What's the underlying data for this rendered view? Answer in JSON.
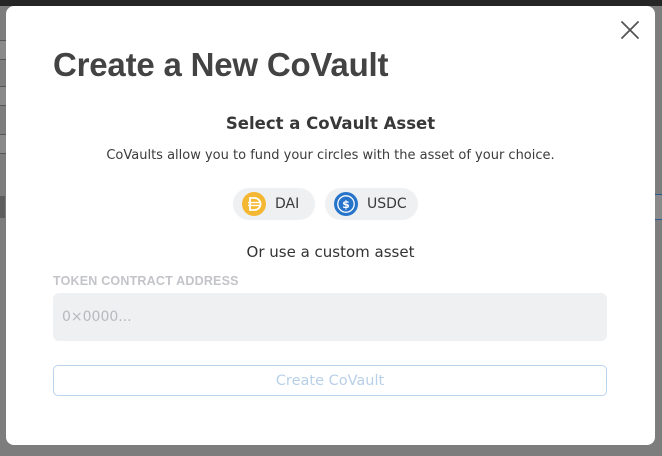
{
  "modal": {
    "title": "Create a New CoVault",
    "close_icon": "close-icon",
    "section_title": "Select a CoVault Asset",
    "section_description": "CoVaults allow you to fund your circles with the asset of your choice.",
    "assets": [
      {
        "label": "DAI",
        "icon": "dai-icon",
        "color": "#F4B731"
      },
      {
        "label": "USDC",
        "icon": "usdc-icon",
        "color": "#2775CA"
      }
    ],
    "custom_asset_text": "Or use a custom asset",
    "token_field": {
      "label": "TOKEN CONTRACT ADDRESS",
      "value": "",
      "placeholder": "0×0000..."
    },
    "create_button_label": "Create CoVault"
  },
  "colors": {
    "overlay": "#7d7d7d",
    "modal_background": "#ffffff",
    "button_border": "#b9d3ec",
    "input_background": "#eff0f2"
  }
}
